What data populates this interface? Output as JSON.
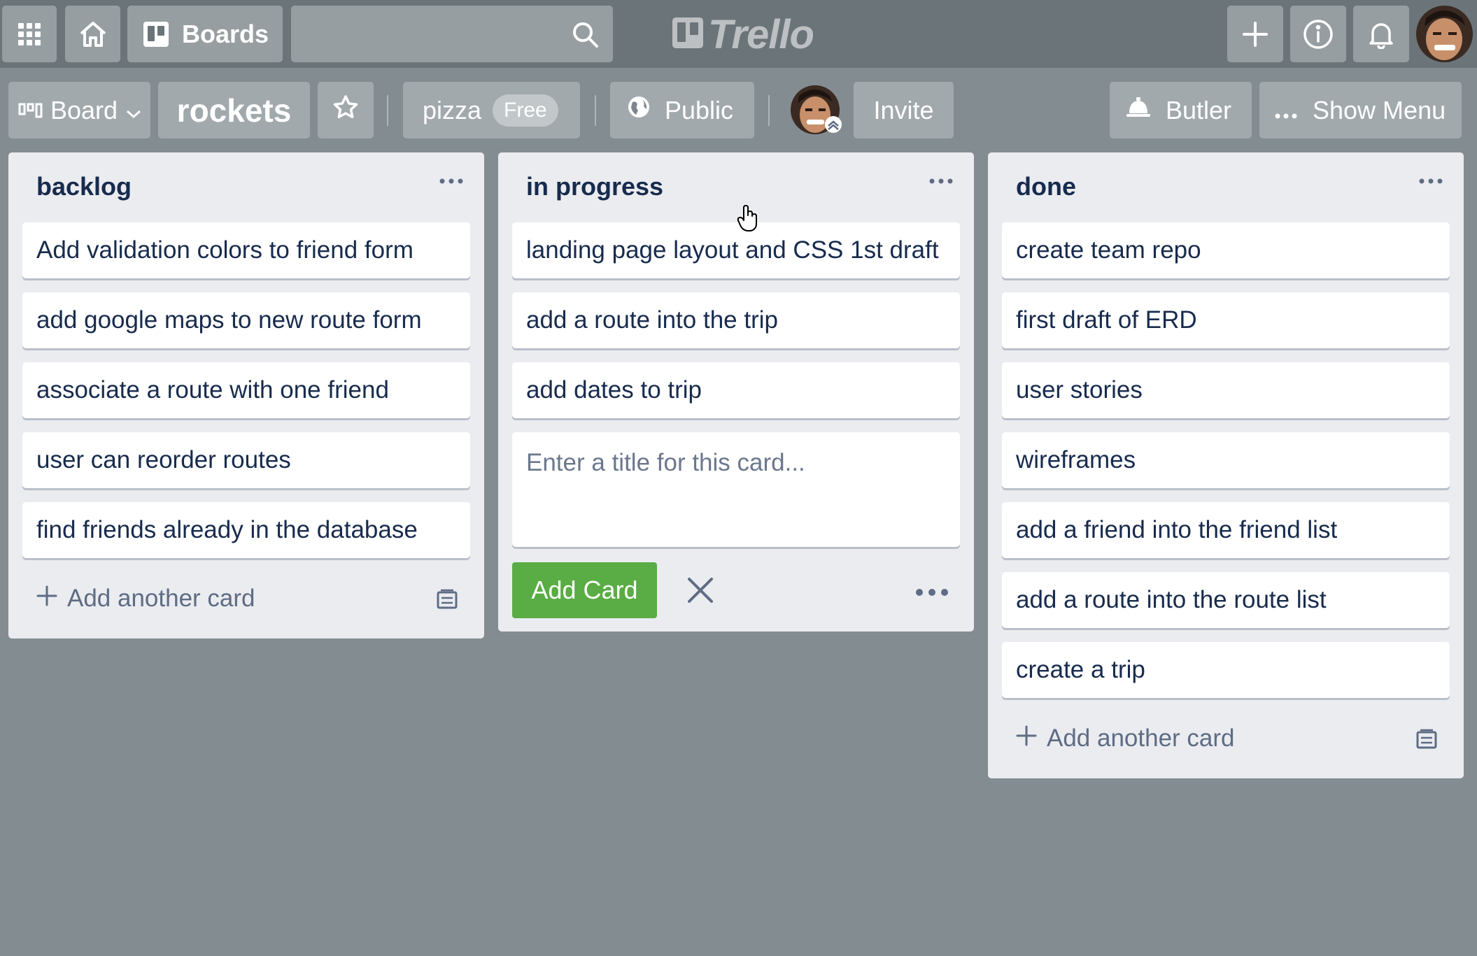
{
  "topbar": {
    "boards_label": "Boards",
    "search_placeholder": "",
    "logo_text": "Trello"
  },
  "board_header": {
    "view_label": "Board",
    "board_name": "rockets",
    "team_name": "pizza",
    "plan_badge": "Free",
    "visibility_label": "Public",
    "invite_label": "Invite",
    "butler_label": "Butler",
    "show_menu_label": "Show Menu"
  },
  "lists": [
    {
      "title": "backlog",
      "cards": [
        "Add validation colors to friend form",
        "add google maps to new route form",
        "associate a route with one friend",
        "user can reorder routes",
        "find friends already in the database"
      ],
      "add_card_label": "Add another card"
    },
    {
      "title": "in progress",
      "cards": [
        "landing page layout and CSS 1st draft",
        "add a route into the trip",
        "add dates to trip"
      ],
      "composer_placeholder": "Enter a title for this card...",
      "add_button_label": "Add Card"
    },
    {
      "title": "done",
      "cards": [
        "create team repo",
        "first draft of ERD",
        "user stories",
        "wireframes",
        "add a friend into the friend list",
        "add a route into the route list",
        "create a trip"
      ],
      "add_card_label": "Add another card"
    }
  ],
  "colors": {
    "background": "#838c91",
    "topbar": "#6b7479",
    "list_bg": "#ebecf0",
    "accent_green": "#5aac44",
    "text": "#172b4d"
  }
}
